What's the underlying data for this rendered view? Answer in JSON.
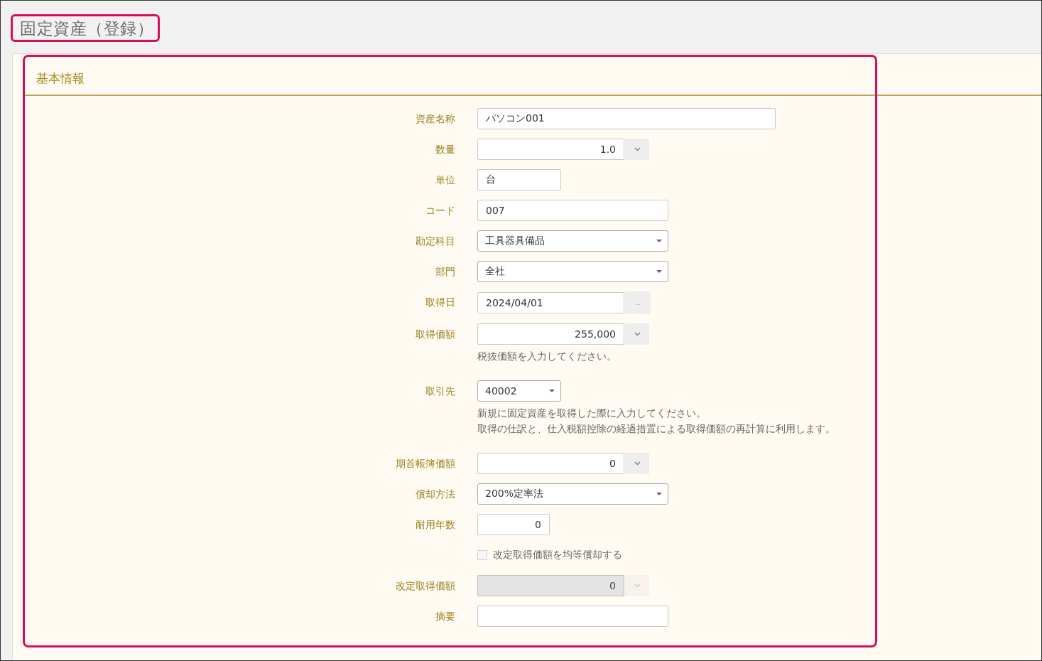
{
  "page": {
    "title": "固定資産（登録）"
  },
  "section": {
    "title": "基本情報"
  },
  "fields": [
    {
      "kind": "text",
      "label": "資産名称",
      "value": "パソコン001",
      "disabled": false
    },
    {
      "kind": "number",
      "label": "数量",
      "value": "1.0",
      "disabled": false
    },
    {
      "kind": "text",
      "label": "単位",
      "value": "台",
      "disabled": false
    },
    {
      "kind": "text",
      "label": "コード",
      "value": "007",
      "disabled": false
    },
    {
      "kind": "select",
      "label": "勘定科目",
      "value": "工具器具備品",
      "disabled": false
    },
    {
      "kind": "select",
      "label": "部門",
      "value": "全社",
      "disabled": false
    },
    {
      "kind": "date",
      "label": "取得日",
      "value": "2024/04/01",
      "button": "...",
      "disabled": false
    },
    {
      "kind": "number",
      "label": "取得価額",
      "value": "255,000",
      "disabled": false,
      "hint": [
        "税抜価額を入力してください。"
      ]
    },
    {
      "kind": "select",
      "label": "取引先",
      "value": "40002",
      "disabled": false,
      "hint": [
        "新規に固定資産を取得した際に入力してください。",
        "取得の仕訳と、仕入税額控除の経過措置による取得価額の再計算に利用します。"
      ]
    },
    {
      "kind": "number",
      "label": "期首帳簿価額",
      "value": "0",
      "disabled": false
    },
    {
      "kind": "select",
      "label": "償却方法",
      "value": "200%定率法",
      "disabled": false
    },
    {
      "kind": "integer",
      "label": "耐用年数",
      "value": "0",
      "disabled": false
    },
    {
      "kind": "checkbox",
      "text": "改定取得価額を均等償却する",
      "checked": false,
      "disabled": true
    },
    {
      "kind": "number",
      "label": "改定取得価額",
      "value": "0",
      "disabled": true
    },
    {
      "kind": "text",
      "label": "摘要",
      "disabled": false
    }
  ]
}
